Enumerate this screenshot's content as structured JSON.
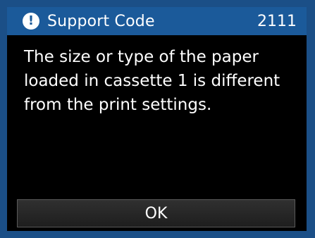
{
  "header": {
    "title": "Support Code",
    "code": "2111",
    "icon": "alert-icon",
    "icon_glyph": "!"
  },
  "message": {
    "lines": [
      "The size or type of the paper",
      "loaded in cassette 1 is different",
      "from the print settings."
    ]
  },
  "actions": {
    "ok_label": "OK"
  },
  "colors": {
    "frame": "#1b4f87",
    "titlebar": "#1b5a9a",
    "panel": "#000000",
    "text": "#ffffff"
  }
}
